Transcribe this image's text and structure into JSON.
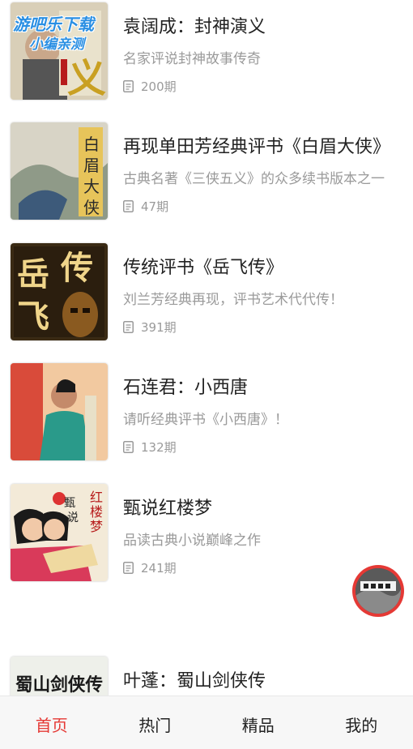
{
  "colors": {
    "accent": "#e53935",
    "muted_text": "#9a9a9a"
  },
  "watermark": {
    "line1": "游吧乐下载",
    "line2": "小编亲测"
  },
  "items": [
    {
      "title": "袁阔成：封神演义",
      "desc": "名家评说封神故事传奇",
      "count": "200期",
      "cover_icon": "fengshen-cover"
    },
    {
      "title": "再现单田芳经典评书《白眉大侠》",
      "desc": "古典名著《三侠五义》的众多续书版本之一",
      "count": "47期",
      "cover_icon": "baimei-cover",
      "cover_text": [
        "白",
        "眉",
        "大",
        "侠"
      ]
    },
    {
      "title": "传统评书《岳飞传》",
      "desc": "刘兰芳经典再现，评书艺术代代传！",
      "count": "391期",
      "cover_icon": "yuefei-cover",
      "cover_text": [
        "岳",
        "传",
        "飞"
      ]
    },
    {
      "title": "石连君：小西唐",
      "desc": "请听经典评书《小西唐》！",
      "count": "132期",
      "cover_icon": "xiaoxitang-cover"
    },
    {
      "title": "甄说红楼梦",
      "desc": "品读古典小说巅峰之作",
      "count": "241期",
      "cover_icon": "hongloumeng-cover",
      "cover_text": [
        "甄",
        "说",
        "红",
        "楼",
        "梦"
      ]
    },
    {
      "title": "叶蓬：蜀山剑侠传",
      "desc": "",
      "count": "",
      "cover_icon": "shushan-cover",
      "cover_text": "蜀山剑侠传"
    }
  ],
  "float_button": {
    "icon": "now-playing-icon"
  },
  "tabs": [
    {
      "label": "首页",
      "active": true
    },
    {
      "label": "热门",
      "active": false
    },
    {
      "label": "精品",
      "active": false
    },
    {
      "label": "我的",
      "active": false
    }
  ]
}
